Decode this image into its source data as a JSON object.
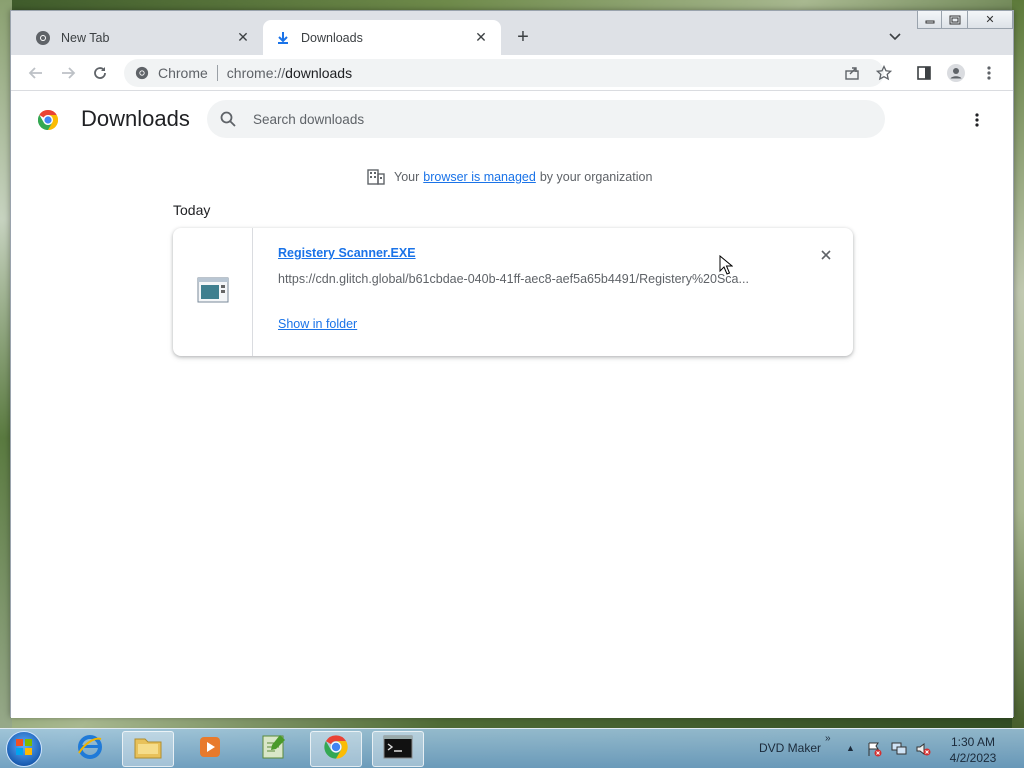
{
  "browser": {
    "tabs": [
      {
        "title": "New Tab",
        "active": false
      },
      {
        "title": "Downloads",
        "active": true
      }
    ],
    "omnibox": {
      "site_name": "Chrome",
      "url_scheme": "chrome://",
      "url_host": "downloads"
    }
  },
  "downloads_page": {
    "title": "Downloads",
    "search_placeholder": "Search downloads",
    "managed_notice": {
      "prefix": "Your",
      "link": "browser is managed",
      "suffix": "by your organization"
    },
    "date_heading": "Today",
    "items": [
      {
        "file_name": "Registery Scanner.EXE",
        "url": "https://cdn.glitch.global/b61cbdae-040b-41ff-aec8-aef5a65b4491/Registery%20Sca...",
        "action": "Show in folder"
      }
    ]
  },
  "taskbar": {
    "tray_label": "DVD Maker",
    "time": "1:30 AM",
    "date": "4/2/2023"
  },
  "colors": {
    "link_blue": "#1a73e8",
    "tab_strip": "#dee1e6"
  }
}
